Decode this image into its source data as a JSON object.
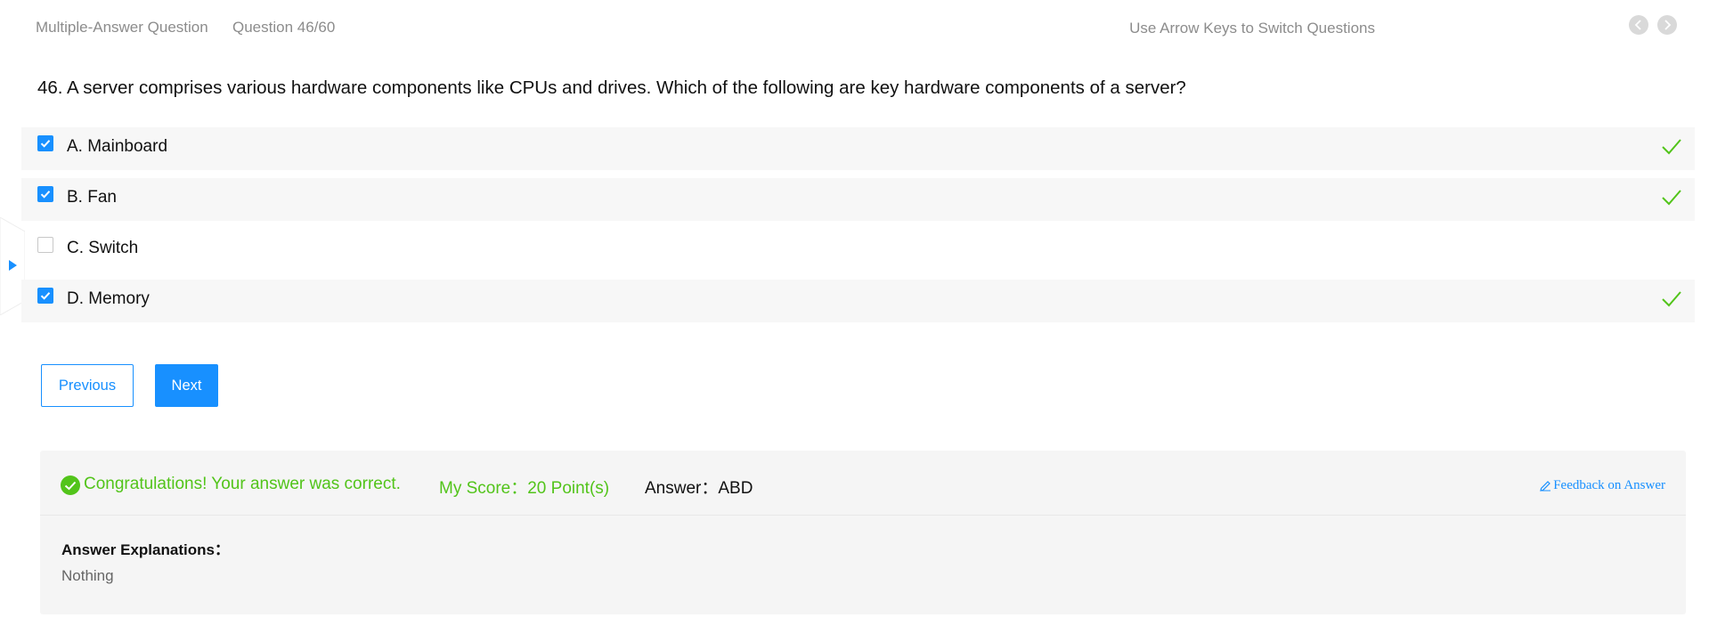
{
  "header": {
    "question_type": "Multiple-Answer Question",
    "question_index": "Question 46/60",
    "hint": "Use Arrow Keys to Switch Questions",
    "prev_icon": "chevron-left-icon",
    "next_icon": "chevron-right-icon"
  },
  "question": {
    "text": "46. A server comprises various hardware components like CPUs and drives. Which of the following are key hardware components of a server?"
  },
  "options": [
    {
      "label": "A. Mainboard",
      "checked": true,
      "correct": true
    },
    {
      "label": "B. Fan",
      "checked": true,
      "correct": true
    },
    {
      "label": "C. Switch",
      "checked": false,
      "correct": false
    },
    {
      "label": "D. Memory",
      "checked": true,
      "correct": true
    }
  ],
  "buttons": {
    "previous": "Previous",
    "next": "Next"
  },
  "result": {
    "message": "Congratulations! Your answer was correct.",
    "score": "My Score：20 Point(s)",
    "answer": "Answer：ABD",
    "feedback": "Feedback on Answer",
    "explanation_title": "Answer Explanations：",
    "explanation_body": "Nothing"
  },
  "colors": {
    "accent": "#1890ff",
    "success": "#52c41a",
    "muted_text": "#8c8c8c",
    "row_bg": "#f7f7f7",
    "panel_bg": "#f5f5f5"
  }
}
